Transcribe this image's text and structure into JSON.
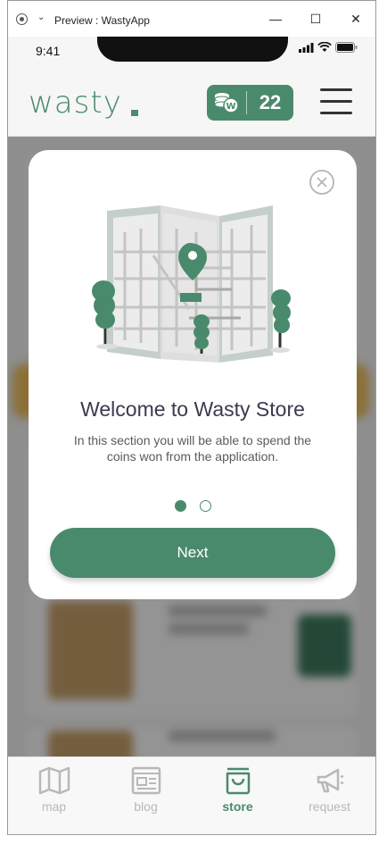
{
  "window": {
    "title": "Preview : WastyApp",
    "minimize_glyph": "—",
    "maximize_glyph": "☐",
    "close_glyph": "✕"
  },
  "status_bar": {
    "time": "9:41"
  },
  "header": {
    "logo": "wasty",
    "coin_count": "22"
  },
  "modal": {
    "title": "Welcome to Wasty Store",
    "description": "In this section you will be able to spend the coins won from the application.",
    "next_label": "Next",
    "pages": 2,
    "active_page": 1
  },
  "bottom_nav": {
    "items": [
      {
        "label": "map",
        "icon": "map-icon",
        "active": false
      },
      {
        "label": "blog",
        "icon": "blog-icon",
        "active": false
      },
      {
        "label": "store",
        "icon": "shopping-bag-icon",
        "active": true
      },
      {
        "label": "request",
        "icon": "megaphone-icon",
        "active": false
      }
    ]
  },
  "colors": {
    "brand": "#4a8a6c",
    "inactive": "#b8b8b8",
    "title_text": "#3a3a50"
  }
}
